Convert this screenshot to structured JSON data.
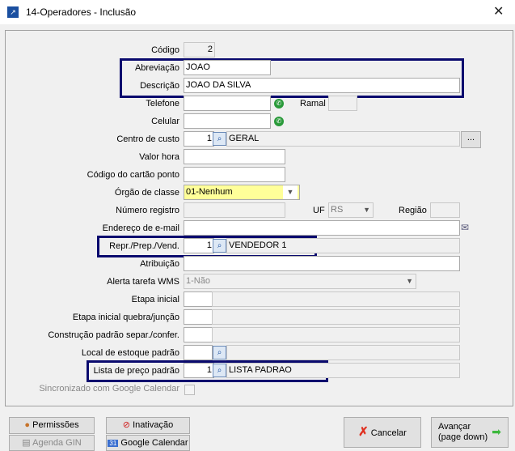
{
  "window": {
    "title": "14-Operadores - Inclusão"
  },
  "labels": {
    "codigo": "Código",
    "abreviacao": "Abreviação",
    "descricao": "Descrição",
    "telefone": "Telefone",
    "ramal": "Ramal",
    "celular": "Celular",
    "centro_custo": "Centro de custo",
    "valor_hora": "Valor hora",
    "cartao_ponto": "Código do cartão ponto",
    "orgao_classe": "Órgão de classe",
    "numero_registro": "Número registro",
    "uf": "UF",
    "regiao": "Região",
    "email": "Endereço de e-mail",
    "repr": "Repr./Prep./Vend.",
    "atribuicao": "Atribuição",
    "alerta": "Alerta tarefa WMS",
    "etapa_inicial": "Etapa inicial",
    "etapa_quebra": "Etapa inicial quebra/junção",
    "construcao": "Construção padrão separ./confer.",
    "local_estoque": "Local de estoque padrão",
    "lista_preco": "Lista de preço padrão",
    "sincronizado": "Sincronizado com Google Calendar"
  },
  "values": {
    "codigo": "2",
    "abreviacao": "JOAO",
    "descricao": "JOAO DA SILVA",
    "centro_custo_code": "1",
    "centro_custo_name": "GERAL",
    "centro_custo_more": "...",
    "orgao_classe": "01-Nenhum",
    "uf": "RS",
    "alerta": "1-Não",
    "repr_code": "1",
    "repr_name": "VENDEDOR 1",
    "lista_code": "1",
    "lista_name": "LISTA PADRAO"
  },
  "buttons": {
    "permissoes": "Permissões",
    "inativacao": "Inativação",
    "agenda_gin": "Agenda GIN",
    "google_calendar": "Google Calendar",
    "google_icon": "31",
    "cancelar": "Cancelar",
    "avancar_1": "Avançar",
    "avancar_2": "(page down)"
  },
  "colors": {
    "highlight": "#0a0a6e",
    "orgao_bg": "#ffff99"
  }
}
